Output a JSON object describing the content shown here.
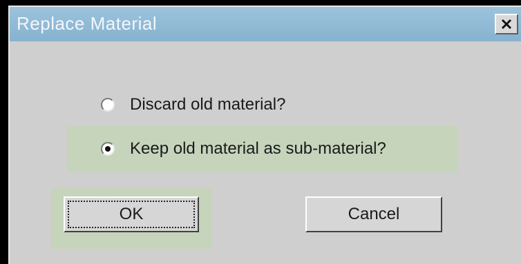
{
  "dialog": {
    "title": "Replace Material",
    "close_icon": "close-icon"
  },
  "options": [
    {
      "label": "Discard old material?",
      "selected": false
    },
    {
      "label": "Keep old material as sub-material?",
      "selected": true
    }
  ],
  "buttons": {
    "ok_label": "OK",
    "cancel_label": "Cancel"
  },
  "colors": {
    "titlebar": "#8fb9d5",
    "dialog_bg": "#cfcfcf",
    "highlight": "#c5d4bb"
  }
}
